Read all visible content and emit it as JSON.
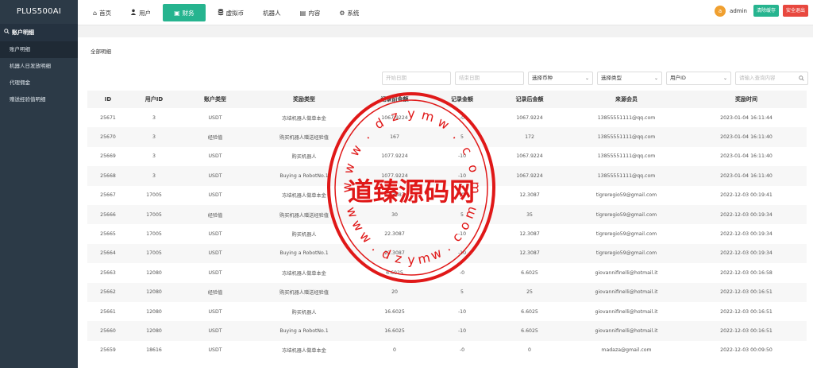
{
  "brand": "PLUS500AI",
  "sidebar": {
    "section": "账户明细",
    "items": [
      {
        "label": "账户明细"
      },
      {
        "label": "机器人日发放明细"
      },
      {
        "label": "代理佣金"
      },
      {
        "label": "赠送经验值明细"
      }
    ]
  },
  "nav": [
    {
      "label": "首页",
      "icon": "⌂"
    },
    {
      "label": "用户",
      "icon": "👤"
    },
    {
      "label": "财务",
      "icon": "▣"
    },
    {
      "label": "虚拟币",
      "icon": "◉"
    },
    {
      "label": "机器人",
      "icon": ""
    },
    {
      "label": "内容",
      "icon": "▤"
    },
    {
      "label": "系统",
      "icon": "⚙"
    }
  ],
  "top_right": {
    "avatar_letter": "a",
    "username": "admin",
    "clear_cache": "清除缓存",
    "logout": "安全退出"
  },
  "panel_title": "全部明细",
  "filters": {
    "start_date": "开始日期",
    "end_date": "结束日期",
    "currency": "选择币种",
    "type": "选择类型",
    "user_id": "用户ID",
    "search_placeholder": "请输入查询内容"
  },
  "table": {
    "headers": [
      "ID",
      "用户ID",
      "账户类型",
      "奖励类型",
      "记录前金额",
      "记录金额",
      "记录后金额",
      "来源会员",
      "奖励时间"
    ],
    "rows": [
      [
        "25671",
        "3",
        "USDT",
        "冻结机器人做单本金",
        "1067.9224",
        "-0",
        "1067.9224",
        "13855551111@qq.com",
        "2023-01-04 16:11:44"
      ],
      [
        "25670",
        "3",
        "经验值",
        "购买机器人赠送经验值",
        "167",
        "5",
        "172",
        "13855551111@qq.com",
        "2023-01-04 16:11:40"
      ],
      [
        "25669",
        "3",
        "USDT",
        "购买机器人",
        "1077.9224",
        "-10",
        "1067.9224",
        "13855551111@qq.com",
        "2023-01-04 16:11:40"
      ],
      [
        "25668",
        "3",
        "USDT",
        "Buying a RobotNo.1",
        "1077.9224",
        "-10",
        "1067.9224",
        "13855551111@qq.com",
        "2023-01-04 16:11:40"
      ],
      [
        "25667",
        "17005",
        "USDT",
        "冻结机器人做单本金",
        "12.3087",
        "-0",
        "12.3087",
        "tigreregio59@gmail.com",
        "2022-12-03 00:19:41"
      ],
      [
        "25666",
        "17005",
        "经验值",
        "购买机器人赠送经验值",
        "30",
        "5",
        "35",
        "tigreregio59@gmail.com",
        "2022-12-03 00:19:34"
      ],
      [
        "25665",
        "17005",
        "USDT",
        "购买机器人",
        "22.3087",
        "-10",
        "12.3087",
        "tigreregio59@gmail.com",
        "2022-12-03 00:19:34"
      ],
      [
        "25664",
        "17005",
        "USDT",
        "Buying a RobotNo.1",
        "22.3087",
        "-10",
        "12.3087",
        "tigreregio59@gmail.com",
        "2022-12-03 00:19:34"
      ],
      [
        "25663",
        "12080",
        "USDT",
        "冻结机器人做单本金",
        "6.6025",
        "-0",
        "6.6025",
        "giovannifinelli@hotmail.it",
        "2022-12-03 00:16:58"
      ],
      [
        "25662",
        "12080",
        "经验值",
        "购买机器人赠送经验值",
        "20",
        "5",
        "25",
        "giovannifinelli@hotmail.it",
        "2022-12-03 00:16:51"
      ],
      [
        "25661",
        "12080",
        "USDT",
        "购买机器人",
        "16.6025",
        "-10",
        "6.6025",
        "giovannifinelli@hotmail.it",
        "2022-12-03 00:16:51"
      ],
      [
        "25660",
        "12080",
        "USDT",
        "Buying a RobotNo.1",
        "16.6025",
        "-10",
        "6.6025",
        "giovannifinelli@hotmail.it",
        "2022-12-03 00:16:51"
      ],
      [
        "25659",
        "18616",
        "USDT",
        "冻结机器人做单本金",
        "0",
        "-0",
        "0",
        "madaza@gmail.com",
        "2022-12-03 00:09:50"
      ]
    ]
  },
  "watermark": {
    "text": "道臻源码网",
    "ring_text": "www.dzymw.com",
    "color": "#e01818"
  }
}
